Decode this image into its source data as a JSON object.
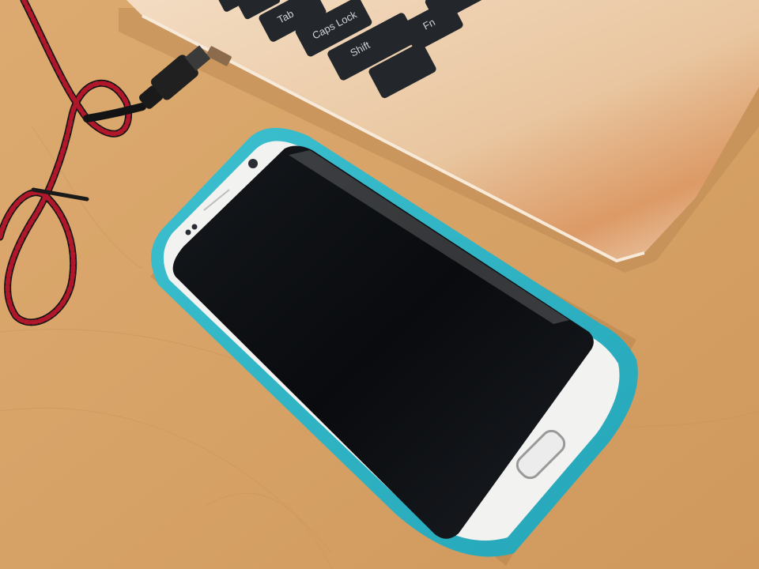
{
  "scene": {
    "colors": {
      "desk": "#d9a66c",
      "laptop_body": "#e8c8a4",
      "keycap": "#23272c",
      "phone_case": "#2fb3c4",
      "phone_body": "#f2f2f0",
      "screen": "#0b0d10",
      "cable_red": "#b0172a",
      "cable_black": "#141414"
    },
    "keyboard": {
      "key_tab": "Tab",
      "key_caps": "Caps Lock",
      "key_shift": "Shift",
      "key_fn": "Fn"
    }
  }
}
